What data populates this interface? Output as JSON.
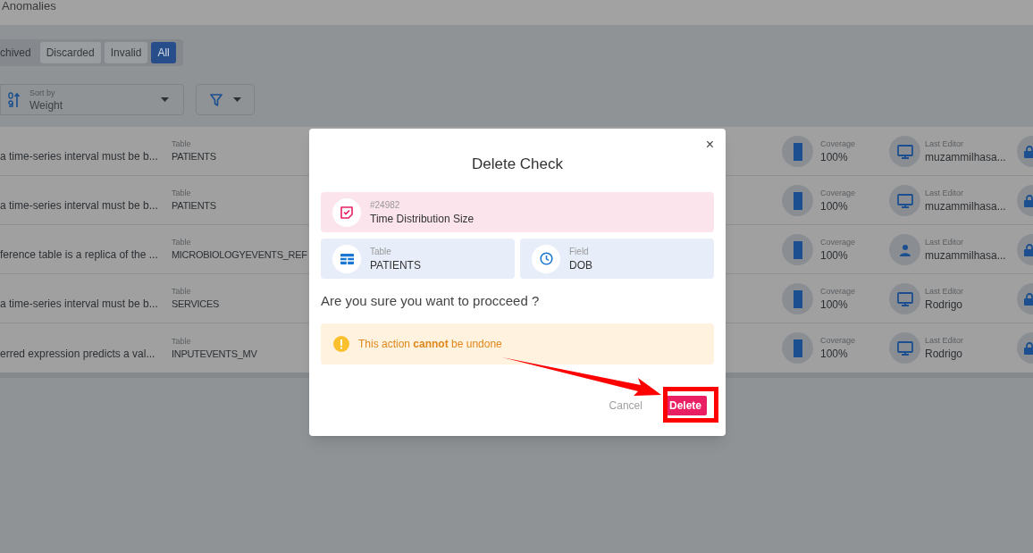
{
  "header": {
    "title": "Anomalies"
  },
  "status_tabs": [
    {
      "label": "chived",
      "selected": false
    },
    {
      "label": "Discarded",
      "selected": false
    },
    {
      "label": "Invalid",
      "selected": false
    },
    {
      "label": "All",
      "selected": true
    }
  ],
  "sort": {
    "label": "Sort by",
    "value": "Weight"
  },
  "rows": [
    {
      "description": "a time-series interval must be b...",
      "table_label": "Table",
      "table": "PATIENTS",
      "coverage_label": "Coverage",
      "coverage": "100%",
      "editor_label": "Last Editor",
      "editor": "muzammilhasa...",
      "kind": "system"
    },
    {
      "description": "a time-series interval must be b...",
      "table_label": "Table",
      "table": "PATIENTS",
      "coverage_label": "Coverage",
      "coverage": "100%",
      "editor_label": "Last Editor",
      "editor": "muzammilhasa...",
      "kind": "system"
    },
    {
      "description": "ference table is a replica of the ...",
      "table_label": "Table",
      "table": "MICROBIOLOGYEVENTS_REF",
      "coverage_label": "Coverage",
      "coverage": "100%",
      "editor_label": "Last Editor",
      "editor": "muzammilhasa...",
      "kind": "user"
    },
    {
      "description": "a time-series interval must be b...",
      "table_label": "Table",
      "table": "SERVICES",
      "coverage_label": "Coverage",
      "coverage": "100%",
      "editor_label": "Last Editor",
      "editor": "Rodrigo",
      "kind": "system"
    },
    {
      "description": "erred expression predicts a val...",
      "table_label": "Table",
      "table": "INPUTEVENTS_MV",
      "coverage_label": "Coverage",
      "coverage": "100%",
      "editor_label": "Last Editor",
      "editor": "Rodrigo",
      "kind": "system"
    }
  ],
  "dialog": {
    "title": "Delete Check",
    "close": "×",
    "check": {
      "id": "#24982",
      "name": "Time Distribution Size"
    },
    "table": {
      "label": "Table",
      "value": "PATIENTS"
    },
    "field": {
      "label": "Field",
      "value": "DOB"
    },
    "question": "Are you sure you want to procceed ?",
    "warning": "This action **cannot** be undone",
    "buttons": [
      {
        "label": "Cancel",
        "kind": "secondary"
      },
      {
        "label": "Delete",
        "kind": "danger"
      }
    ]
  }
}
